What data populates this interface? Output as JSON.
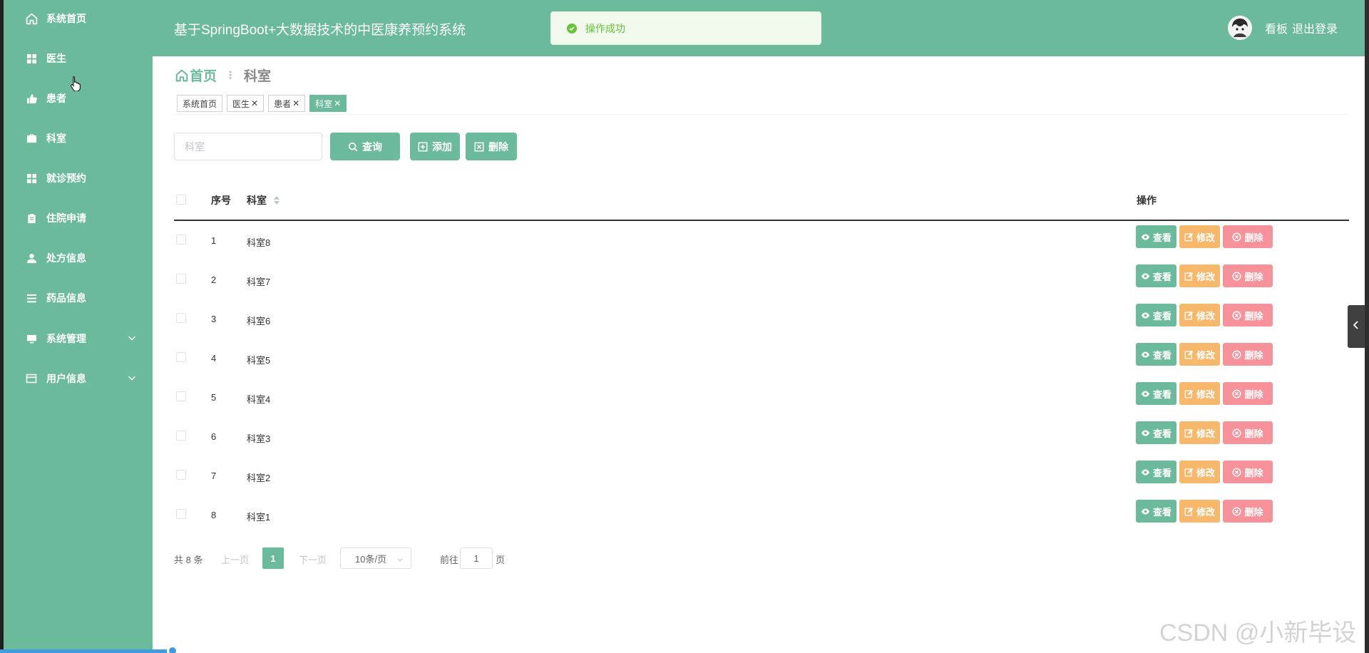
{
  "header": {
    "title": "基于SpringBoot+大数据技术的中医康养预约系统",
    "user_name": "看板",
    "logout_label": "退出登录"
  },
  "toast": {
    "message": "操作成功"
  },
  "sidebar": {
    "items": [
      {
        "label": "系统首页",
        "icon": "home-icon"
      },
      {
        "label": "医生",
        "icon": "grid-icon"
      },
      {
        "label": "患者",
        "icon": "thumb-icon"
      },
      {
        "label": "科室",
        "icon": "briefcase-icon"
      },
      {
        "label": "就诊预约",
        "icon": "grid-icon"
      },
      {
        "label": "住院申请",
        "icon": "clipboard-icon"
      },
      {
        "label": "处方信息",
        "icon": "user-icon"
      },
      {
        "label": "药品信息",
        "icon": "list-icon"
      },
      {
        "label": "系统管理",
        "icon": "monitor-icon",
        "expandable": true
      },
      {
        "label": "用户信息",
        "icon": "card-icon",
        "expandable": true
      }
    ]
  },
  "breadcrumb": {
    "home": "首页",
    "current": "科室"
  },
  "tags": [
    {
      "label": "系统首页",
      "closable": false,
      "active": false
    },
    {
      "label": "医生",
      "closable": true,
      "active": false
    },
    {
      "label": "患者",
      "closable": true,
      "active": false
    },
    {
      "label": "科室",
      "closable": true,
      "active": true
    }
  ],
  "toolbar": {
    "search_placeholder": "科室",
    "search_label": "查询",
    "add_label": "添加",
    "delete_label": "删除"
  },
  "table": {
    "columns": {
      "index": "序号",
      "dept": "科室",
      "actions": "操作"
    },
    "rows": [
      {
        "index": "1",
        "dept": "科室8"
      },
      {
        "index": "2",
        "dept": "科室7"
      },
      {
        "index": "3",
        "dept": "科室6"
      },
      {
        "index": "4",
        "dept": "科室5"
      },
      {
        "index": "5",
        "dept": "科室4"
      },
      {
        "index": "6",
        "dept": "科室3"
      },
      {
        "index": "7",
        "dept": "科室2"
      },
      {
        "index": "8",
        "dept": "科室1"
      }
    ],
    "actions": {
      "view": "查看",
      "edit": "修改",
      "delete": "删除"
    }
  },
  "pagination": {
    "total": "共 8 条",
    "prev": "上一页",
    "current": "1",
    "next": "下一页",
    "page_size": "10条/页",
    "goto": "前往",
    "goto_value": "1",
    "page_unit": "页"
  },
  "watermark": "CSDN @小新毕设",
  "colors": {
    "primary": "#6aba9b",
    "edit": "#f8b86c",
    "delete": "#f7929a",
    "success": "#67c23a"
  }
}
